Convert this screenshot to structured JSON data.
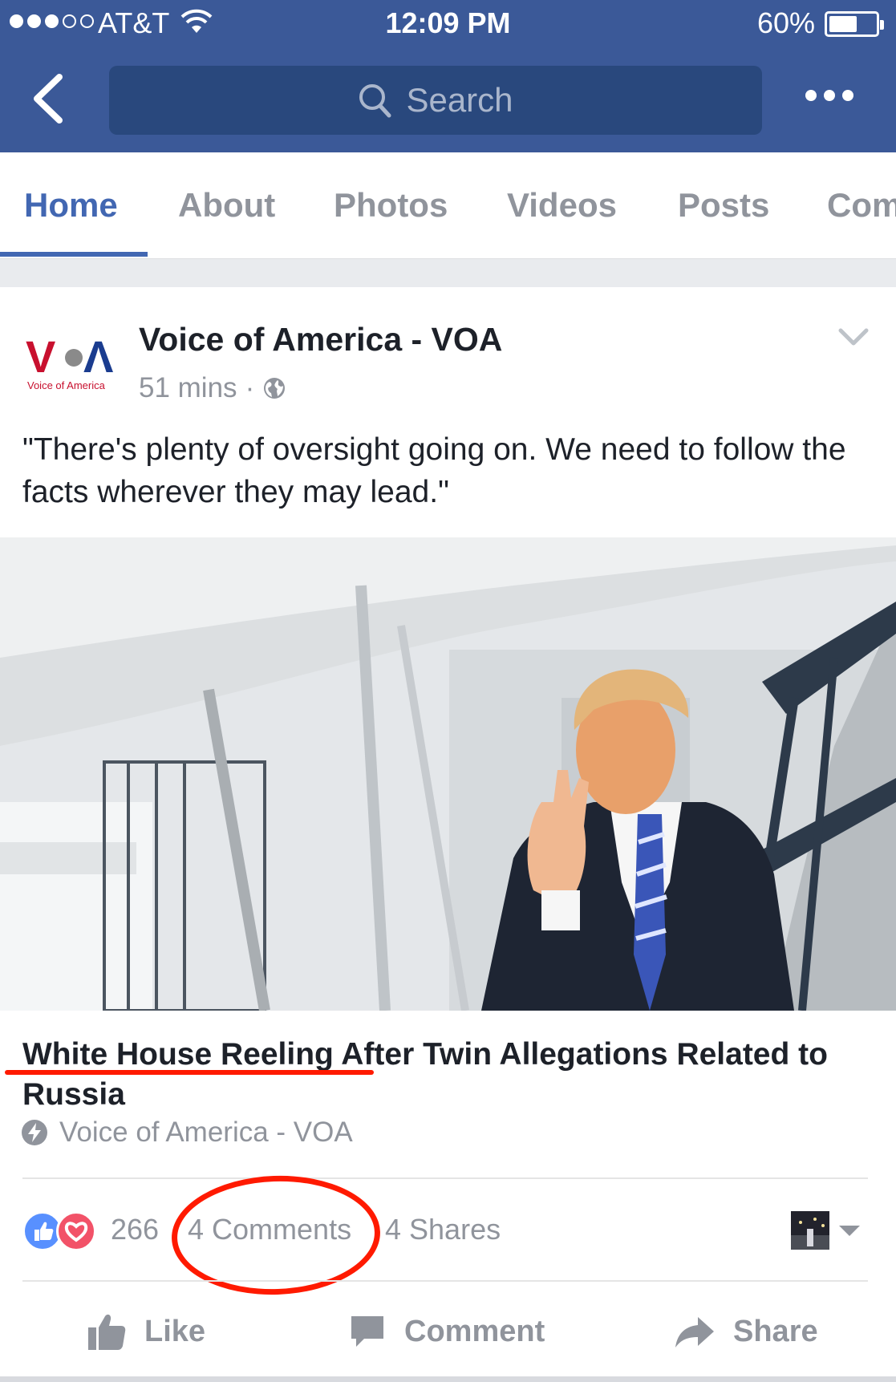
{
  "status_bar": {
    "carrier": "AT&T",
    "time": "12:09 PM",
    "battery_percent": "60%",
    "battery_level": 0.6,
    "signal_dots_filled": 3,
    "signal_dots_total": 5
  },
  "nav": {
    "back_icon": "chevron-left-icon",
    "search_placeholder": "Search",
    "more_icon": "more-horizontal-icon"
  },
  "tabs": [
    {
      "label": "Home",
      "active": true
    },
    {
      "label": "About",
      "active": false
    },
    {
      "label": "Photos",
      "active": false
    },
    {
      "label": "Videos",
      "active": false
    },
    {
      "label": "Posts",
      "active": false
    },
    {
      "label": "Com",
      "active": false
    }
  ],
  "post": {
    "page_logo_text": "VOA",
    "page_logo_subtext": "Voice of America",
    "page_name": "Voice of America - VOA",
    "time_ago": "51 mins",
    "separator": "·",
    "privacy_icon": "globe-icon",
    "text": "\"There's plenty of oversight going on. We need to follow the facts wherever they may lead.\"",
    "link_title": "White House Reeling After Twin Allegations Related to Russia",
    "link_source": "Voice of America - VOA",
    "reactions_count": "266",
    "comments_count": "4 Comments",
    "shares_count": "4 Shares",
    "actions": {
      "like": "Like",
      "comment": "Comment",
      "share": "Share"
    }
  },
  "colors": {
    "brand_blue": "#3b5998",
    "search_bg": "#29487d",
    "tab_active": "#4267b2",
    "muted_text": "#90949c",
    "annotation_red": "#ff1a00"
  }
}
